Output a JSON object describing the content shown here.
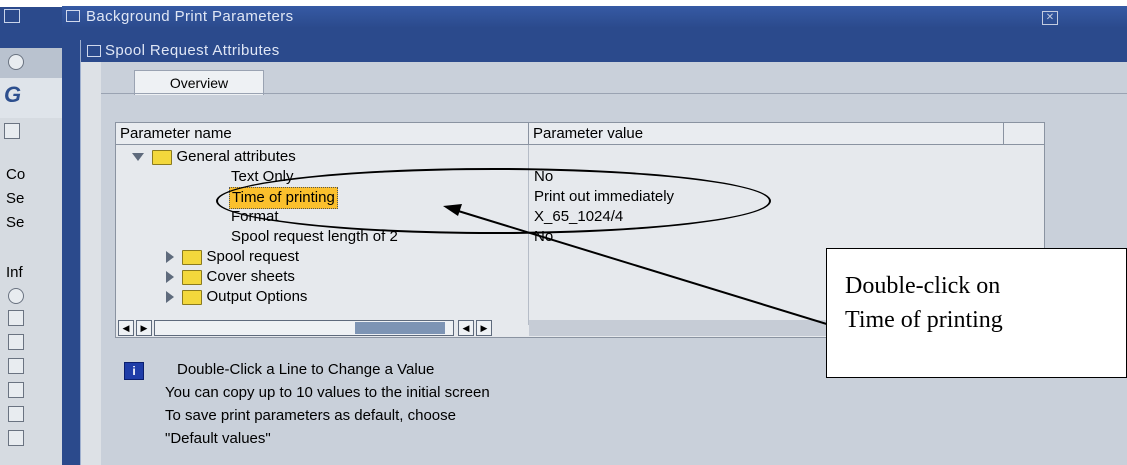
{
  "window_outer": {
    "title": "Background Print Parameters"
  },
  "window_inner": {
    "title": "Spool Request Attributes"
  },
  "background_window": {
    "title_fragment": "G",
    "labels": [
      "Co",
      "Se",
      "Se",
      "Inf"
    ]
  },
  "tabs": [
    {
      "label": "Overview"
    }
  ],
  "table": {
    "headers": [
      "Parameter name",
      "Parameter value"
    ],
    "rows": [
      {
        "name": "General attributes",
        "value": "",
        "level": 0,
        "expanded": true,
        "folder": true
      },
      {
        "name": "Text Only",
        "value": "No",
        "level": 1
      },
      {
        "name": "Time of printing",
        "value": "Print out immediately",
        "level": 1,
        "highlighted": true
      },
      {
        "name": "Format",
        "value": "X_65_1024/4",
        "level": 1
      },
      {
        "name": "Spool request length of 2",
        "value": "No",
        "level": 1
      },
      {
        "name": "Spool request",
        "value": "",
        "level": 0,
        "expanded": false,
        "folder": true
      },
      {
        "name": "Cover sheets",
        "value": "",
        "level": 0,
        "expanded": false,
        "folder": true
      },
      {
        "name": "Output Options",
        "value": "",
        "level": 0,
        "expanded": false,
        "folder": true
      }
    ]
  },
  "info": {
    "lines": [
      "Double-Click a Line to Change a Value",
      "You can copy up to 10 values to the initial screen",
      "To save print parameters as default, choose",
      "\"Default values\""
    ]
  },
  "annotation": {
    "callout_line1": "Double-click on",
    "callout_line2": "Time of printing"
  },
  "colors": {
    "sap_blue": "#2b4a8c",
    "highlight": "#fbc02d",
    "folder": "#f3d83c"
  }
}
